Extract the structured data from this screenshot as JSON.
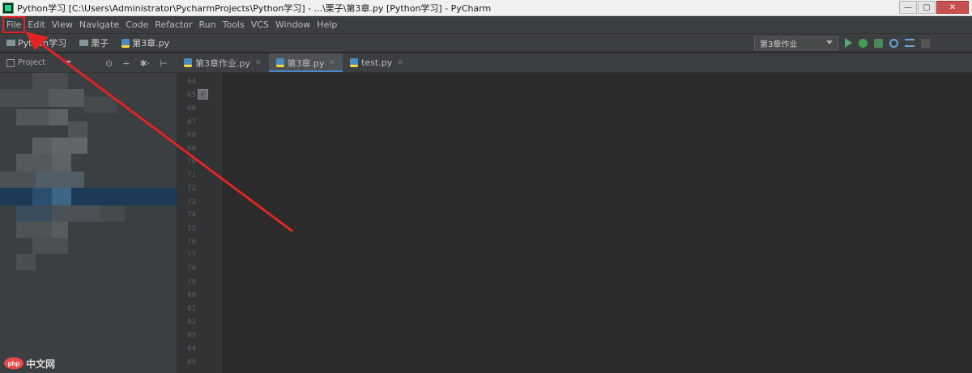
{
  "window": {
    "title": "Python学习 [C:\\Users\\Administrator\\PycharmProjects\\Python学习] - ...\\栗子\\第3章.py [Python学习] - PyCharm",
    "controls": {
      "minimize": "—",
      "maximize": "▢",
      "close": "✕"
    }
  },
  "menu": {
    "items": [
      "File",
      "Edit",
      "View",
      "Navigate",
      "Code",
      "Refactor",
      "Run",
      "Tools",
      "VCS",
      "Window",
      "Help"
    ],
    "highlighted_item": "File"
  },
  "navbar": {
    "breadcrumbs": [
      {
        "label": "Python学习",
        "icon": "folder-icon"
      },
      {
        "label": "栗子",
        "icon": "folder-icon"
      },
      {
        "label": "第3章.py",
        "icon": "python-file-icon"
      }
    ],
    "run_config": "第3章作业",
    "toolbar_icons": [
      "run-icon",
      "debug-icon",
      "coverage-icon",
      "profile-icon",
      "stop-icon",
      "vcs-icon"
    ]
  },
  "project_panel": {
    "title": "Project",
    "tool_icons": [
      "⊙",
      "÷",
      "✱·",
      "⊢"
    ]
  },
  "tabs": [
    {
      "label": "第3章作业.py",
      "active": false
    },
    {
      "label": "第3章.py",
      "active": true
    },
    {
      "label": "test.py",
      "active": false
    }
  ],
  "gutter": {
    "line_numbers": [
      "64",
      "65",
      "66",
      "67",
      "68",
      "69",
      "70",
      "71",
      "72",
      "73",
      "74",
      "75",
      "76",
      "77",
      "78",
      "79",
      "80",
      "81",
      "82",
      "83",
      "84",
      "85"
    ]
  },
  "annotation": {
    "color": "#e02424"
  },
  "watermark": {
    "text": "中文网"
  }
}
